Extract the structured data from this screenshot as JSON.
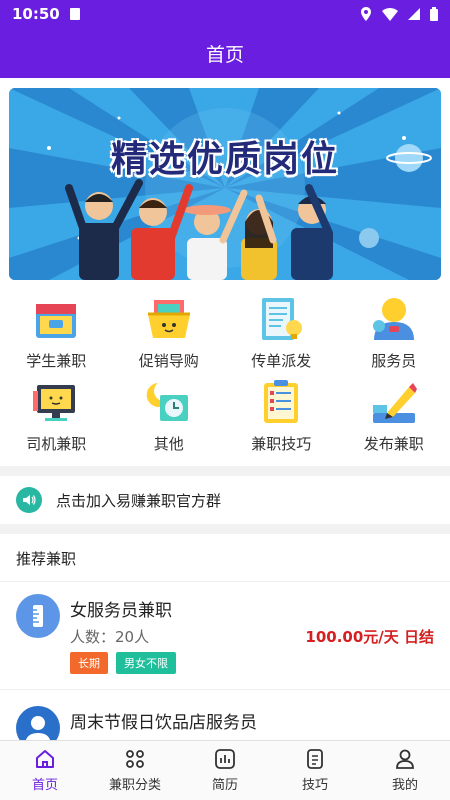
{
  "status_bar": {
    "time": "10:50"
  },
  "app_bar": {
    "title": "首页"
  },
  "banner": {
    "text": "精选优质岗位"
  },
  "categories": [
    {
      "label": "学生兼职",
      "icon": "student-job-icon"
    },
    {
      "label": "促销导购",
      "icon": "promotion-basket-icon"
    },
    {
      "label": "传单派发",
      "icon": "flyer-icon"
    },
    {
      "label": "服务员",
      "icon": "waiter-icon"
    },
    {
      "label": "司机兼职",
      "icon": "driver-monitor-icon"
    },
    {
      "label": "其他",
      "icon": "other-clock-icon"
    },
    {
      "label": "兼职技巧",
      "icon": "checklist-icon"
    },
    {
      "label": "发布兼职",
      "icon": "publish-pencil-icon"
    }
  ],
  "notice": {
    "text": "点击加入易赚兼职官方群",
    "icon": "speaker-icon"
  },
  "recommend": {
    "title": "推荐兼职",
    "jobs": [
      {
        "title": "女服务员兼职",
        "people": "人数：20人",
        "salary": "100.00元/天 日结",
        "tags": [
          "长期",
          "男女不限"
        ],
        "icon": "ruler-icon"
      },
      {
        "title": "周末节假日饮品店服务员",
        "icon": "person-avatar-icon"
      }
    ]
  },
  "tabs": [
    {
      "label": "首页",
      "icon": "home-icon",
      "active": true
    },
    {
      "label": "兼职分类",
      "icon": "category-grid-icon",
      "active": false
    },
    {
      "label": "简历",
      "icon": "resume-chart-icon",
      "active": false
    },
    {
      "label": "技巧",
      "icon": "tips-document-icon",
      "active": false
    },
    {
      "label": "我的",
      "icon": "profile-icon",
      "active": false
    }
  ],
  "colors": {
    "primary": "#6a1fe0",
    "salary": "#d42020",
    "tag_orange": "#f2692b",
    "tag_teal": "#1fbf9c",
    "notice": "#27b7a2"
  }
}
